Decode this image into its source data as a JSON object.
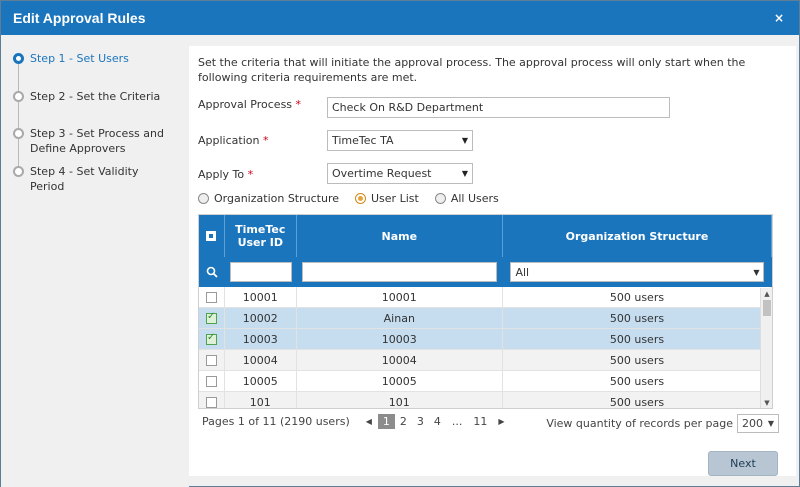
{
  "dialog": {
    "title": "Edit Approval Rules",
    "close_glyph": "×"
  },
  "steps": [
    {
      "label": "Step 1 - Set Users",
      "active": true
    },
    {
      "label": "Step 2 - Set the Criteria",
      "active": false
    },
    {
      "label": "Step 3 - Set Process and Define Approvers",
      "active": false
    },
    {
      "label": "Step 4 - Set Validity Period",
      "active": false
    }
  ],
  "intro": "Set the criteria that will initiate the approval process. The approval process will only start when the following criteria requirements are met.",
  "form": {
    "approval_process": {
      "label": "Approval Process",
      "required": "*",
      "value": "Check On R&D Department"
    },
    "application": {
      "label": "Application",
      "required": "*",
      "value": "TimeTec TA"
    },
    "apply_to": {
      "label": "Apply To",
      "required": "*",
      "value": "Overtime Request"
    }
  },
  "scope": {
    "options": [
      "Organization Structure",
      "User List",
      "All Users"
    ],
    "selected": "User List"
  },
  "grid": {
    "columns": [
      "TimeTec User ID",
      "Name",
      "Organization Structure"
    ],
    "filter_select": "All",
    "rows": [
      {
        "id": "10001",
        "name": "10001",
        "org": "500 users",
        "checked": false
      },
      {
        "id": "10002",
        "name": "Ainan",
        "org": "500 users",
        "checked": true
      },
      {
        "id": "10003",
        "name": "10003",
        "org": "500 users",
        "checked": true
      },
      {
        "id": "10004",
        "name": "10004",
        "org": "500 users",
        "checked": false
      },
      {
        "id": "10005",
        "name": "10005",
        "org": "500 users",
        "checked": false
      },
      {
        "id": "101",
        "name": "101",
        "org": "500 users",
        "checked": false
      }
    ]
  },
  "pager": {
    "info": "Pages 1 of 11 (2190 users)",
    "pages": [
      "1",
      "2",
      "3",
      "4"
    ],
    "ellipsis": "...",
    "last": "11",
    "current": "1"
  },
  "per_page": {
    "label": "View quantity of records per page",
    "value": "200"
  },
  "next_label": "Next",
  "colors": {
    "accent": "#1b75bc",
    "selected_row": "#c6ddf0",
    "check_on": "#2e8b2e"
  }
}
